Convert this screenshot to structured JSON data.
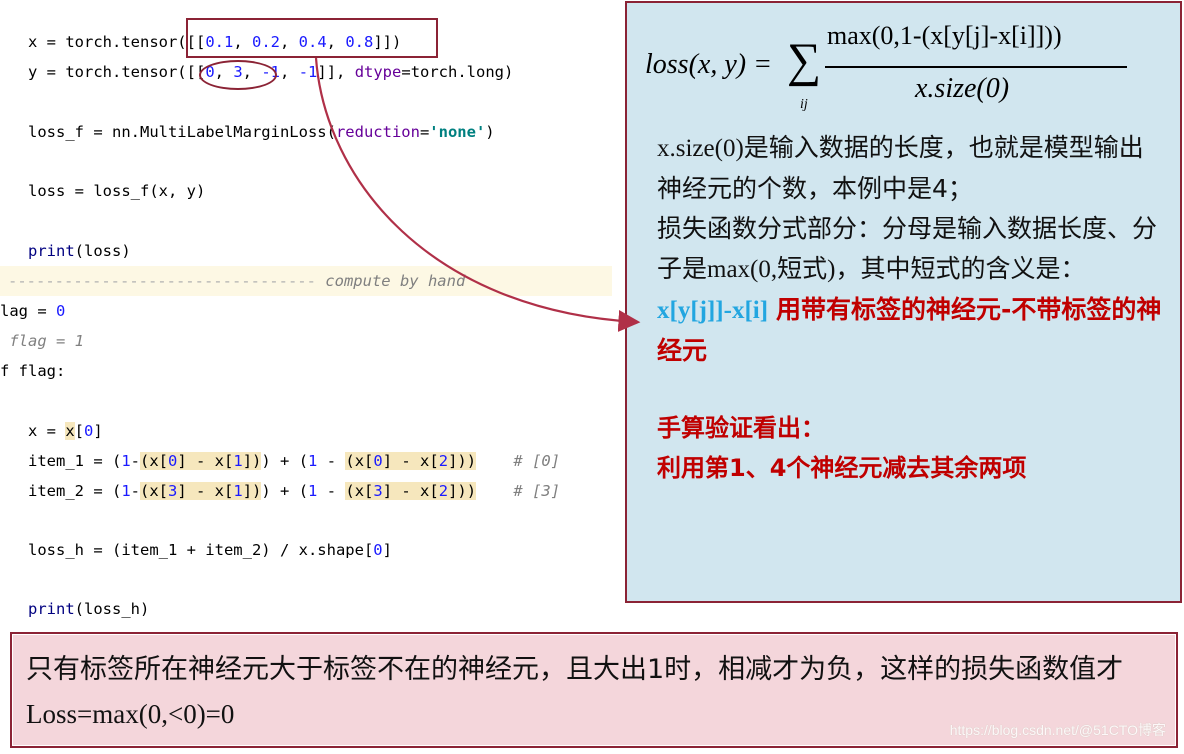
{
  "code": {
    "lines": [
      {
        "id": "x-def",
        "prefix": "x = torch.tensor(",
        "args": "[[0.1, 0.2, 0.4, 0.8]]",
        "suffix": ")"
      },
      {
        "id": "y-def",
        "prefix": "y = torch.tensor(",
        "args": "[[0, 3, -1, -1]]",
        "mid": ", ",
        "param": "dtype",
        "suffix": "=torch.long)"
      },
      {
        "id": "loss-f",
        "prefix": "loss_f = nn.MultiLabelMarginLoss(",
        "param": "reduction",
        "eq": "=",
        "str": "'none'",
        "suffix": ")"
      },
      {
        "id": "loss",
        "text": "loss = loss_f(x, y)"
      },
      {
        "id": "print-loss",
        "fn": "print",
        "text": "(loss)"
      },
      {
        "id": "separator",
        "dashes": "---------------------------------",
        "comment": "compute by hand"
      },
      {
        "id": "flag-0",
        "text": "lag = ",
        "num": "0"
      },
      {
        "id": "flag-1",
        "comment": " flag = 1"
      },
      {
        "id": "if-flag",
        "text": "f flag:"
      },
      {
        "id": "x-index",
        "pre": "x = ",
        "hl": "x",
        "post": "[",
        "num": "0",
        "close": "]"
      },
      {
        "id": "item-1",
        "text": "item_1 = (1-(x[0] - x[1])) + (1 - (x[0] - x[2]))",
        "comment": "# [0]"
      },
      {
        "id": "item-2",
        "text": "item_2 = (1-(x[3] - x[1])) + (1 - (x[3] - x[2]))",
        "comment": "# [3]"
      },
      {
        "id": "loss-h",
        "text": "loss_h = (item_1 + item_2) / x.shape[0]"
      },
      {
        "id": "print-loss-h",
        "fn": "print",
        "text": "(loss_h)"
      }
    ]
  },
  "formula": {
    "lhs": "loss(x, y) =",
    "sum": "∑",
    "sub": "ij",
    "numerator": "max(0,1-(x[y[j]-x[i]]))",
    "denominator": "x.size(0)"
  },
  "panel": {
    "para1_a": "x.size(0)",
    "para1_b": "是输入数据的长度，也就是模型输出神经元的个数，本例中是4；",
    "para2_a": "损失函数分式部分：分母是输入数据长度、分子是",
    "para2_b": "max(0,",
    "para2_c": "短式",
    "para2_d": ")",
    "para2_e": "，其中短式的含义是：",
    "code_expr": "x[y[j]]-x[i]",
    "red_text": "用带有标签的神经元-不带标签的神经元",
    "verify_title": "手算验证看出：",
    "verify_body": "利用第1、4个神经元减去其余两项"
  },
  "bottom": {
    "text_a": "只有标签所在神经元大于标签不在的神经元，且大出1时，相减才为负，这样的损失函数值才",
    "text_b": "Loss=max(0,<0)=0",
    "watermark": "https://blog.csdn.net/@51CTO博客"
  },
  "colors": {
    "accent_border": "#8b2335",
    "panel_bg": "#d1e6ef",
    "bottom_bg": "#f4d6db",
    "highlight": "#f6e7bd",
    "red_text": "#c00000",
    "blue_text": "#22a6e0"
  }
}
